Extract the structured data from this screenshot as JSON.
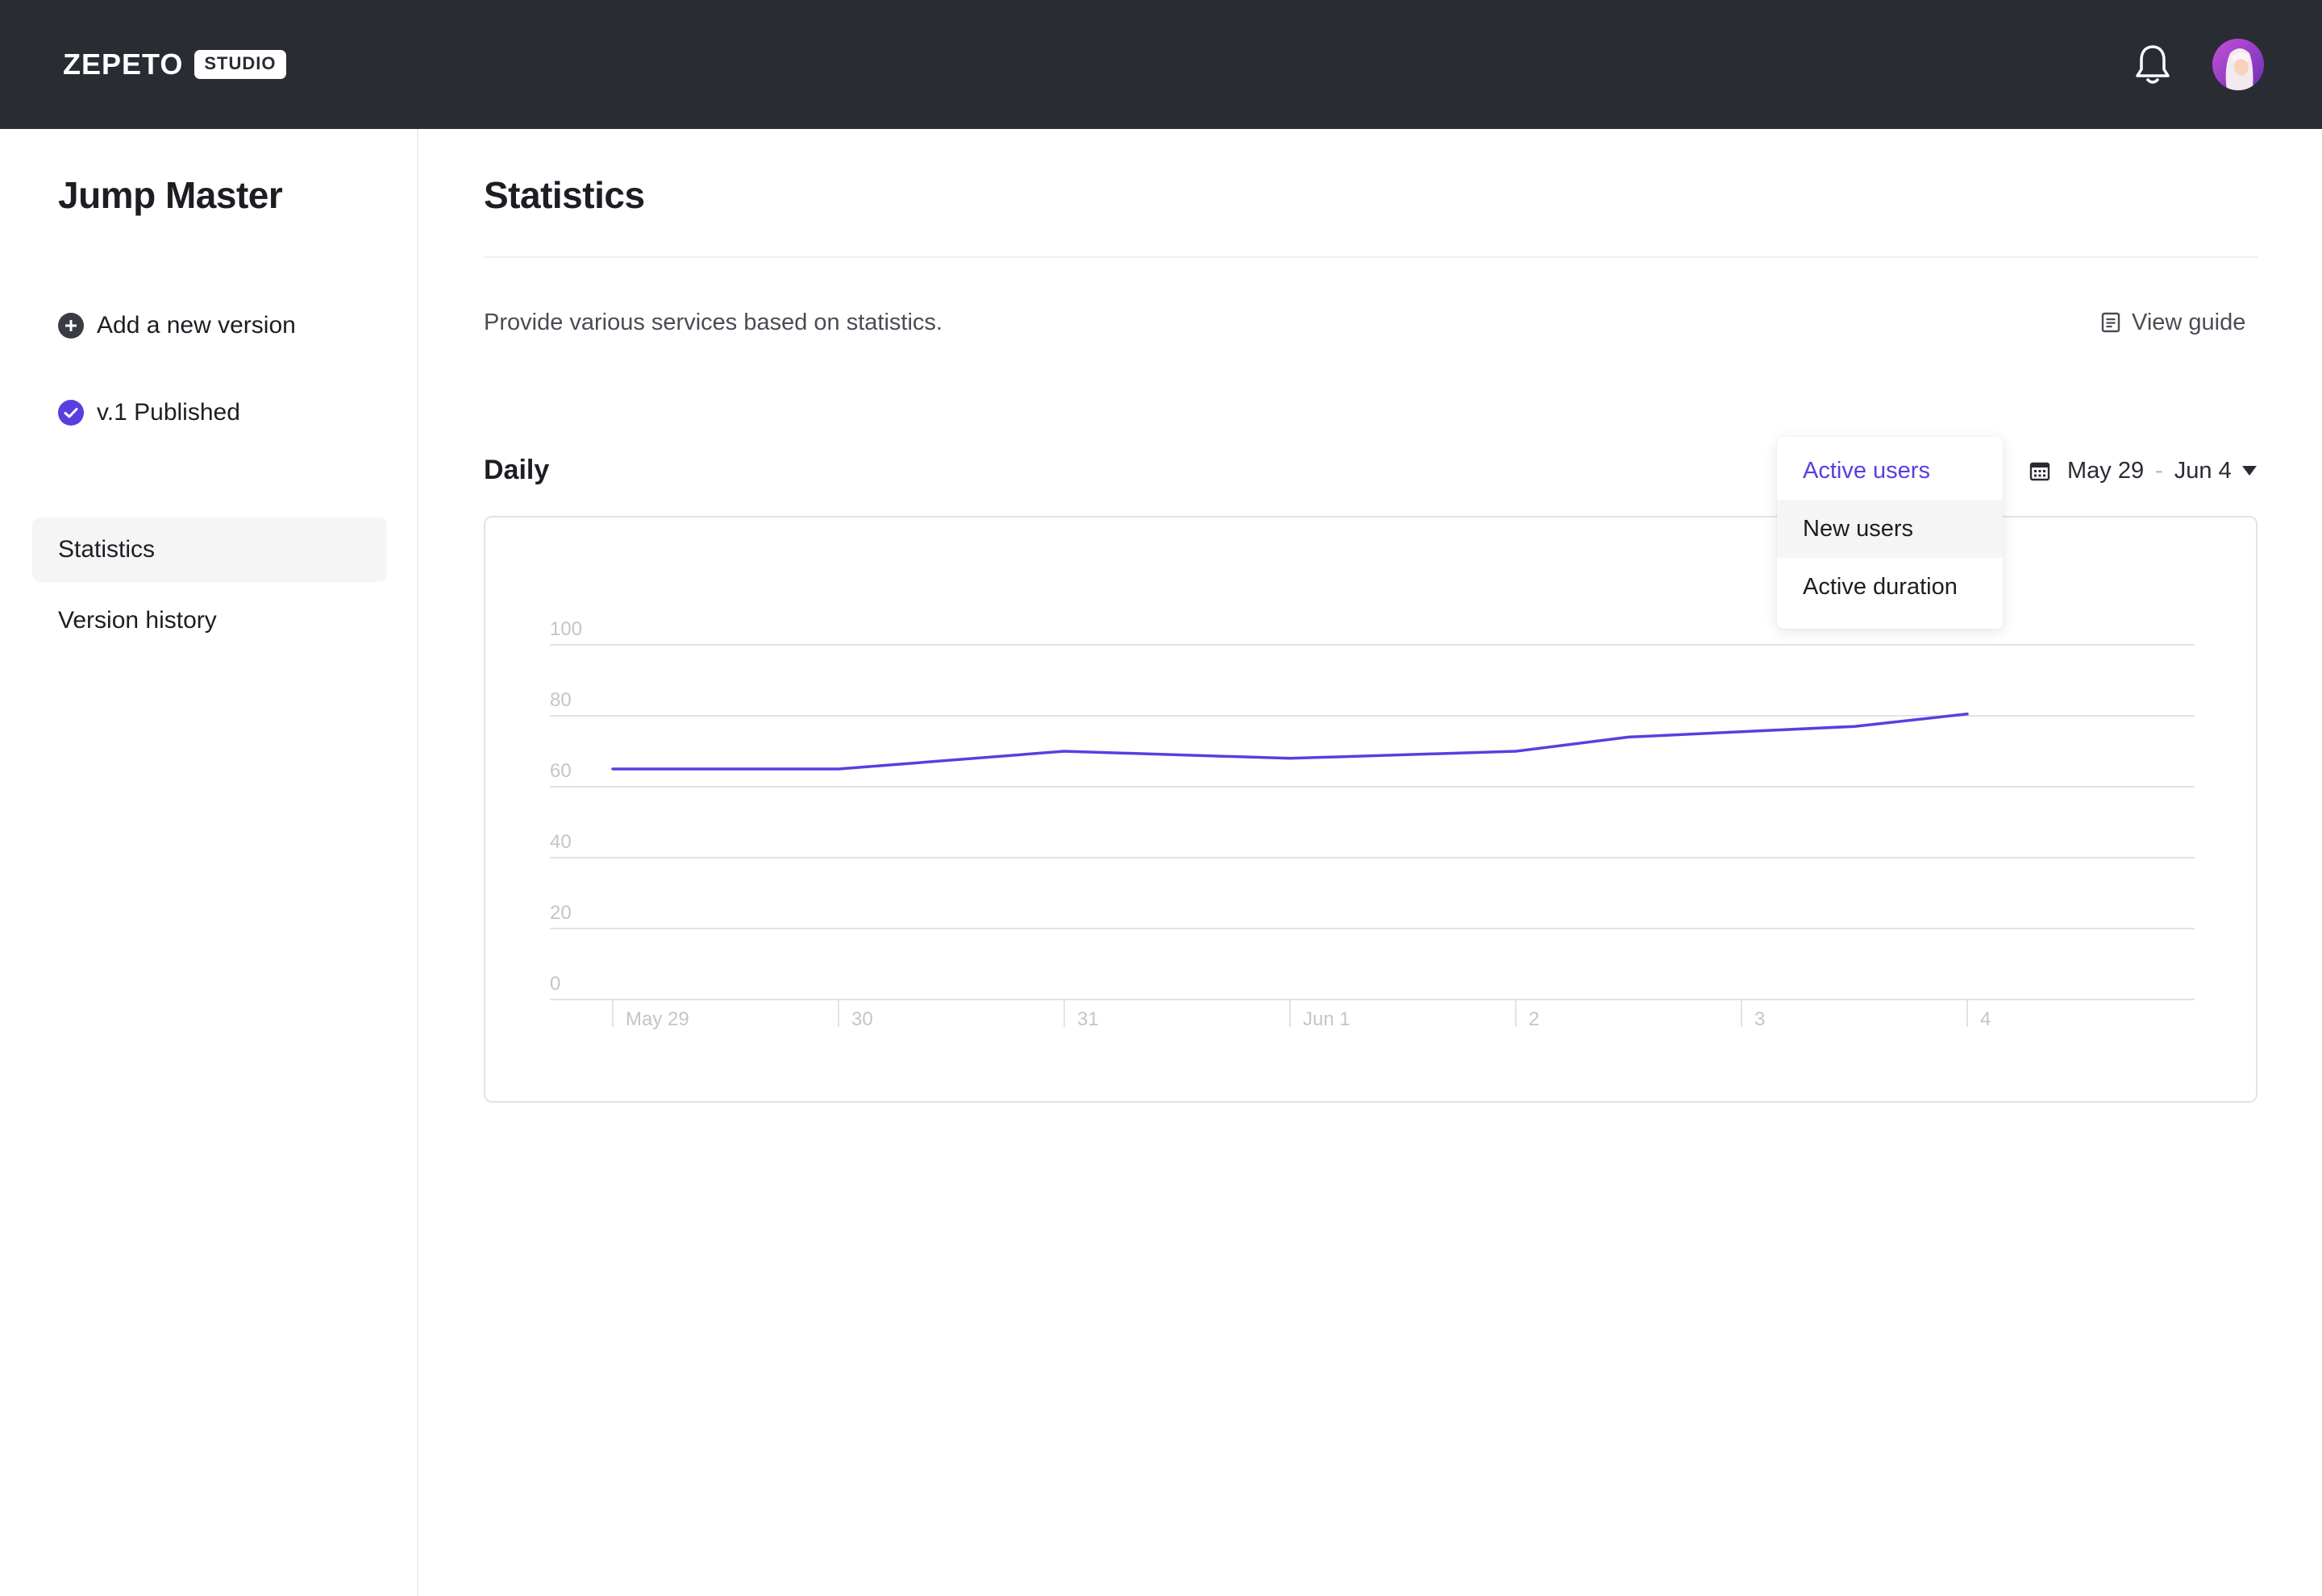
{
  "header": {
    "logo_text": "ZEPETO",
    "logo_badge": "STUDIO",
    "notification_icon": "bell-icon",
    "avatar_icon": "user-avatar"
  },
  "sidebar": {
    "project_title": "Jump Master",
    "add_version_label": "Add a new version",
    "published_label": "v.1 Published",
    "nav": [
      {
        "label": "Statistics",
        "active": true
      },
      {
        "label": "Version history",
        "active": false
      }
    ]
  },
  "main": {
    "title": "Statistics",
    "description": "Provide various services based on statistics.",
    "guide_label": "View guide",
    "section_title": "Daily",
    "date_range": {
      "start": "May 29",
      "separator": "-",
      "end": "Jun 4"
    },
    "metric_dropdown": {
      "options": [
        "Active users",
        "New users",
        "Active duration"
      ],
      "selected": "Active users",
      "hovered": "New users"
    }
  },
  "colors": {
    "accent": "#5a3ee0",
    "topbar": "#2a2c33",
    "grid": "#e2e3e6",
    "tick_text": "#c4c5cb"
  },
  "chart_data": {
    "type": "line",
    "title": "",
    "xlabel": "",
    "ylabel": "",
    "categories": [
      "May 29",
      "30",
      "31",
      "Jun 1",
      "2",
      "3",
      "4"
    ],
    "series": [
      {
        "x": [
          "May 29",
          "May 30",
          "May 31",
          "Jun 1",
          "Jun 2",
          "Jun 3",
          "Jun 4"
        ],
        "values": [
          65,
          65,
          70,
          68,
          70,
          74,
          77
        ]
      }
    ],
    "line_points": [
      {
        "x": "May 29",
        "y": 65
      },
      {
        "x": "May 30",
        "y": 65
      },
      {
        "x": "May 31",
        "y": 70
      },
      {
        "x": "Jun 1",
        "y": 68
      },
      {
        "x": "Jun 2",
        "y": 70
      },
      {
        "x": "Jun 2.5",
        "y": 74
      },
      {
        "x": "Jun 3",
        "y": 75.5
      },
      {
        "x": "Jun 3.5",
        "y": 77
      },
      {
        "x": "Jun 4",
        "y": 80.5
      }
    ],
    "y_ticks": [
      "100",
      "80",
      "60",
      "40",
      "20",
      "0"
    ],
    "ylim": [
      0,
      100
    ],
    "grid": true,
    "legend": "none"
  }
}
